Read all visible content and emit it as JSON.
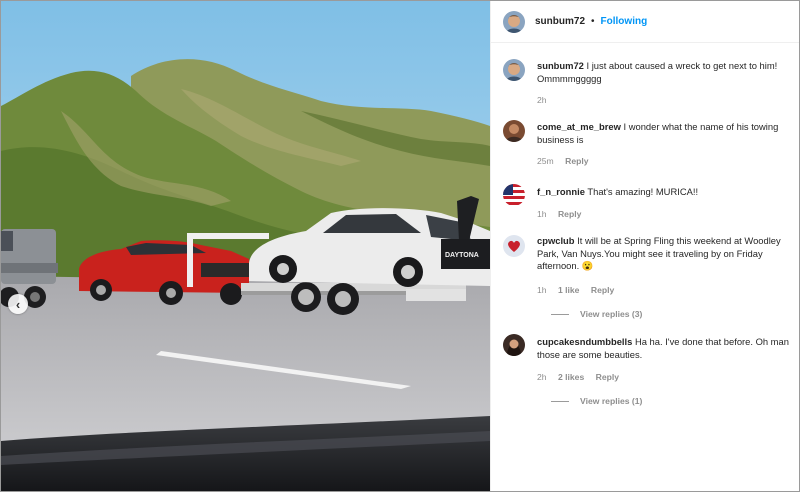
{
  "post": {
    "username": "sunbum72",
    "follow_status": "Following",
    "separator": "•"
  },
  "media": {
    "prev_arrow": "‹",
    "car_plate": "DAYTONA"
  },
  "comments": [
    {
      "user": "sunbum72",
      "text": "I just about caused a wreck to get next to him! Ommmmggggg",
      "time": "2h",
      "likes": "",
      "reply": "",
      "view_replies": ""
    },
    {
      "user": "come_at_me_brew",
      "text": "I wonder what the name of his towing business is",
      "time": "25m",
      "likes": "",
      "reply": "Reply",
      "view_replies": ""
    },
    {
      "user": "f_n_ronnie",
      "text": "That's amazing! MURICA!!",
      "time": "1h",
      "likes": "",
      "reply": "Reply",
      "view_replies": ""
    },
    {
      "user": "cpwclub",
      "text": "It will be at Spring Fling this weekend at Woodley Park, Van Nuys.You might see it traveling by on Friday afternoon.",
      "emoji": "😮",
      "time": "1h",
      "likes": "1 like",
      "reply": "Reply",
      "view_replies": "View replies (3)"
    },
    {
      "user": "cupcakesndumbbells",
      "text": "Ha ha. I've done that before. Oh man those are some beauties.",
      "time": "2h",
      "likes": "2 likes",
      "reply": "Reply",
      "view_replies": "View replies (1)"
    }
  ],
  "colors": {
    "follow_blue": "#0095f6",
    "text": "#262626",
    "muted": "#8e8e8e"
  },
  "icons": {
    "avatar_sunbum": "man-face-avatar",
    "avatar_brew": "brown-avatar",
    "avatar_ronnie": "us-flag-avatar",
    "avatar_cpw": "heart-avatar",
    "avatar_cupcakes": "woman-avatar"
  }
}
